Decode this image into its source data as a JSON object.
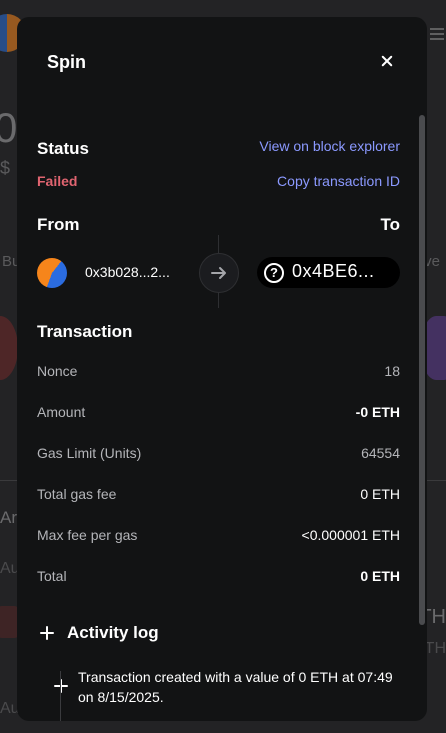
{
  "background": {
    "big_number": "0",
    "currency_prefix": "$",
    "tab_left": "Bu",
    "tab_right": "ve",
    "item_title": "Ar",
    "item_sub1": "Au",
    "item_sub2": "Au",
    "right_title": "TH",
    "right_sub": "TH"
  },
  "modal": {
    "title": "Spin",
    "close_icon": "close-icon"
  },
  "status": {
    "heading": "Status",
    "value": "Failed",
    "value_color": "#e06470",
    "view_explorer_link": "View on block explorer",
    "copy_tx_link": "Copy transaction ID",
    "link_color": "#8b99ff"
  },
  "from_to": {
    "from_heading": "From",
    "to_heading": "To",
    "from_address": "0x3b028...2...",
    "to_address": "0x4BE6...",
    "arrow_icon": "arrow-right-icon",
    "to_icon": "question-circle-icon"
  },
  "transaction": {
    "heading": "Transaction",
    "rows": [
      {
        "label": "Nonce",
        "value": "18"
      },
      {
        "label": "Amount",
        "value": "-0 ETH"
      },
      {
        "label": "Gas Limit (Units)",
        "value": "64554"
      },
      {
        "label": "Total gas fee",
        "value": "0 ETH"
      },
      {
        "label": "Max fee per gas",
        "value": "<0.000001 ETH"
      },
      {
        "label": "Total",
        "value": "0 ETH"
      }
    ]
  },
  "activity": {
    "heading": "Activity log",
    "entries": [
      {
        "text": "Transaction created with a value of 0 ETH at 07:49 on 8/15/2025."
      }
    ]
  }
}
